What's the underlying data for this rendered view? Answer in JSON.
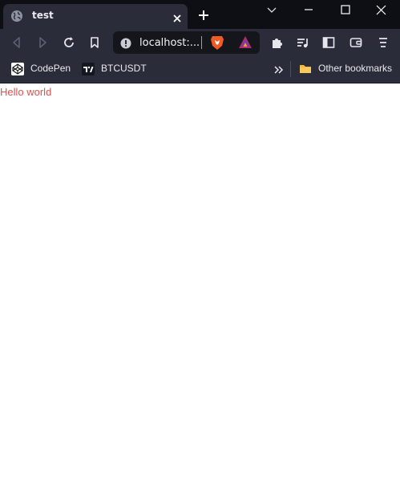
{
  "tab": {
    "title": "test",
    "icon": "globe-icon"
  },
  "omnibox": {
    "url": "localhost:..."
  },
  "bookmarks": {
    "items": [
      {
        "label": "CodePen",
        "icon": "codepen-icon"
      },
      {
        "label": "BTCUSDT",
        "icon": "tradingview-icon"
      }
    ],
    "overflow_icon": "double-chevron-icon",
    "other": {
      "label": "Other bookmarks",
      "icon": "folder-icon"
    }
  },
  "page": {
    "text": "Hello world",
    "text_color": "#d9534f"
  },
  "colors": {
    "frame": "#0e0f15",
    "toolbar": "#2a2d39",
    "omnibox": "#15161c"
  }
}
